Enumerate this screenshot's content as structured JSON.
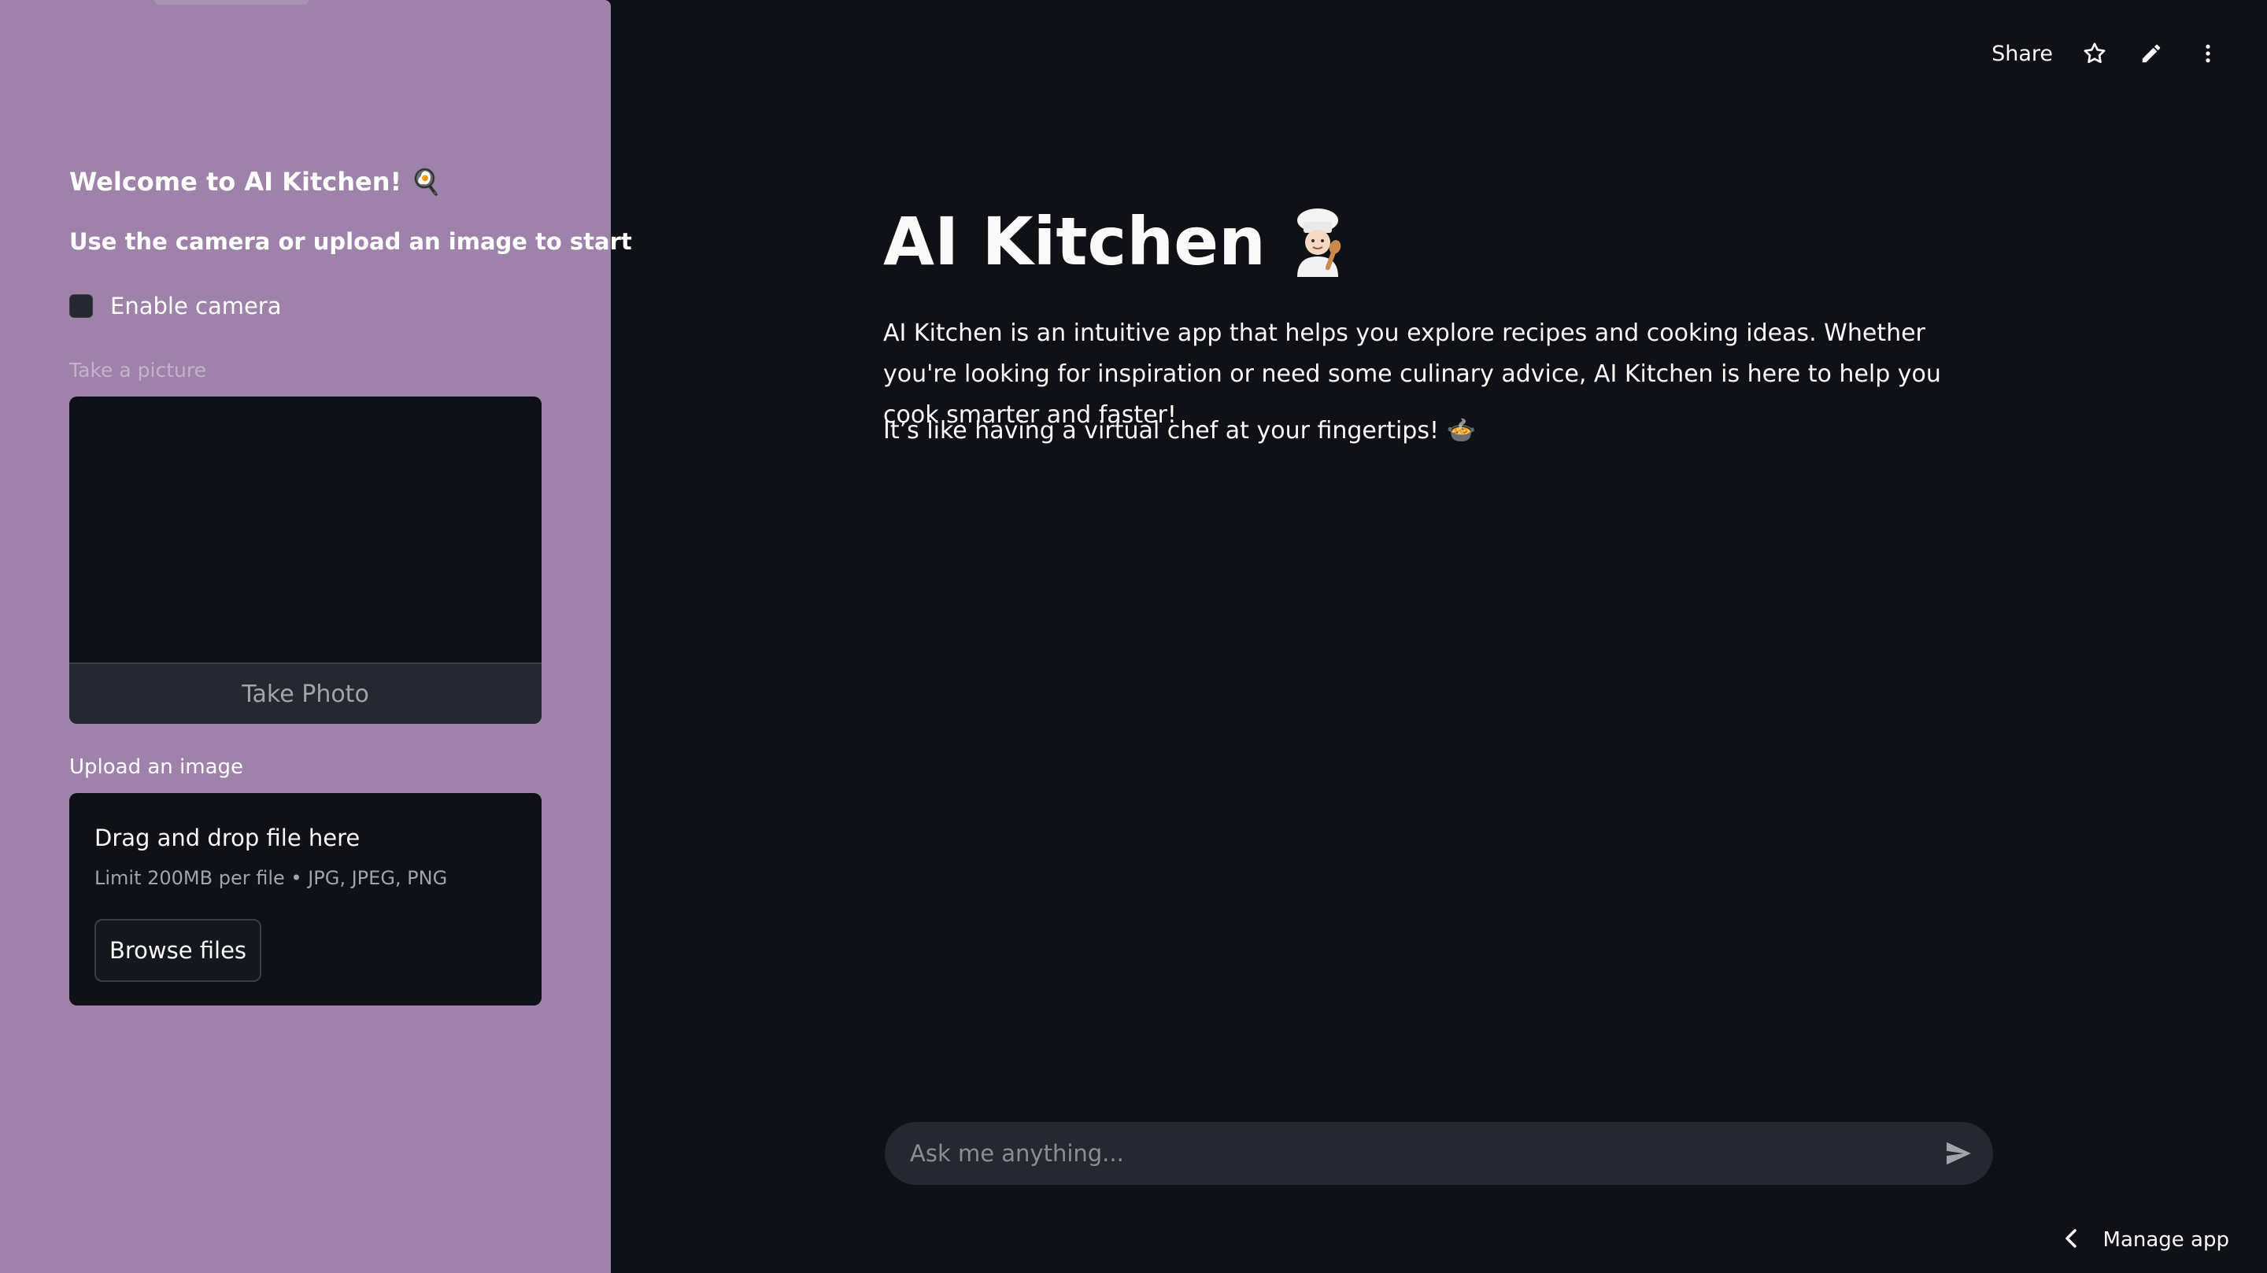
{
  "sidebar": {
    "title": "Welcome to AI Kitchen! 🍳",
    "subtitle": "Use the camera or upload an image to start",
    "camera_toggle_label": "Enable camera",
    "camera_checked": false,
    "camera_input_label": "Take a picture",
    "take_photo_label": "Take Photo",
    "upload_label": "Upload an image",
    "dropzone": {
      "title": "Drag and drop file here",
      "limit": "Limit 200MB per file • JPG, JPEG, PNG",
      "browse_label": "Browse files"
    },
    "background_color": "#9e82aa"
  },
  "toolbar": {
    "share_label": "Share",
    "icons": [
      "star-icon",
      "pencil-icon",
      "more-vertical-icon"
    ]
  },
  "main": {
    "title": "AI Kitchen",
    "title_emoji": "chef-icon",
    "paragraph1": "AI Kitchen is an intuitive app that helps you explore recipes and cooking ideas. Whether you're looking for inspiration or need some culinary advice, AI Kitchen is here to help you cook smarter and faster!",
    "paragraph2": "It’s like having a virtual chef at your fingertips! 🍲"
  },
  "chat": {
    "placeholder": "Ask me anything..."
  },
  "footer": {
    "manage_label": "Manage app"
  }
}
